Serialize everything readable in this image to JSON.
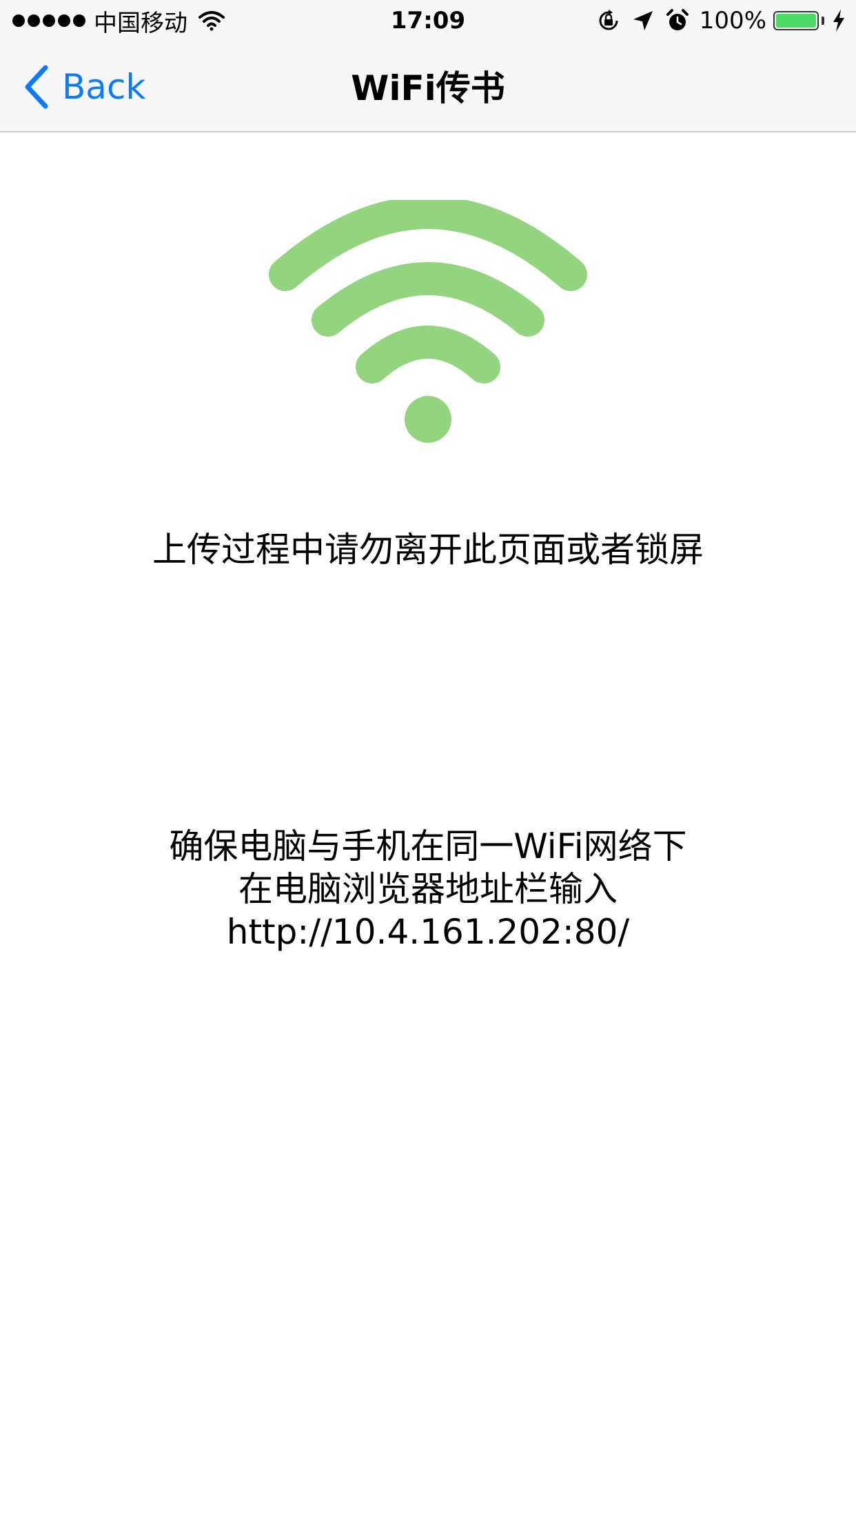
{
  "status_bar": {
    "carrier": "中国移动",
    "time": "17:09",
    "battery_percent": "100%",
    "battery_level": 1.0,
    "battery_color": "#4cd964",
    "icons": [
      "signal-dots-icon",
      "wifi-icon",
      "orientation-lock-icon",
      "location-arrow-icon",
      "alarm-clock-icon",
      "battery-icon",
      "charging-bolt-icon"
    ]
  },
  "nav": {
    "back_label": "Back",
    "back_icon": "chevron-left-icon",
    "title": "WiFi传书",
    "accent_color": "#0a7bff"
  },
  "main": {
    "logo_icon": "wifi-icon",
    "logo_color": "#93d57e",
    "warning": "上传过程中请勿离开此页面或者锁屏",
    "instruction_line1": "确保电脑与手机在同一WiFi网络下",
    "instruction_line2": "在电脑浏览器地址栏输入",
    "address": "http://10.4.161.202:80/"
  }
}
